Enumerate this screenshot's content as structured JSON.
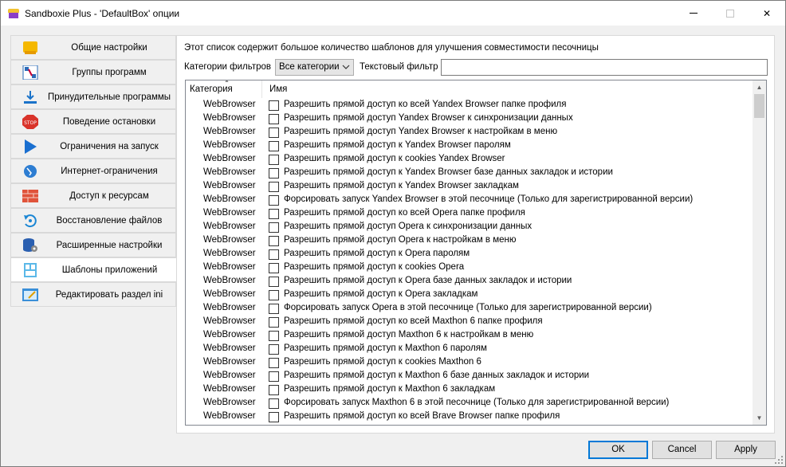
{
  "window": {
    "title": "Sandboxie Plus - 'DefaultBox' опции",
    "minimize_glyph": "",
    "close_glyph": "✕"
  },
  "sidebar": {
    "items": [
      {
        "label": "Общие настройки",
        "icon": "general-settings-icon"
      },
      {
        "label": "Группы программ",
        "icon": "program-groups-icon"
      },
      {
        "label": "Принудительные программы",
        "icon": "forced-programs-icon"
      },
      {
        "label": "Поведение остановки",
        "icon": "stop-icon"
      },
      {
        "label": "Ограничения на запуск",
        "icon": "play-icon"
      },
      {
        "label": "Интернет-ограничения",
        "icon": "globe-icon"
      },
      {
        "label": "Доступ к ресурсам",
        "icon": "brick-wall-icon"
      },
      {
        "label": "Восстановление файлов",
        "icon": "recovery-icon"
      },
      {
        "label": "Расширенные настройки",
        "icon": "database-gear-icon"
      },
      {
        "label": "Шаблоны приложений",
        "icon": "templates-icon",
        "active": true
      },
      {
        "label": "Редактировать раздел ini",
        "icon": "edit-ini-icon"
      }
    ]
  },
  "templates": {
    "description": "Этот список содержит большое количество шаблонов для улучшения совместимости песочницы",
    "filter_categories_label": "Категории фильтров",
    "filter_categories_value": "Все категории",
    "text_filter_label": "Текстовый фильтр",
    "text_filter_value": "",
    "columns": {
      "category": "Категория",
      "name": "Имя"
    },
    "rows": [
      {
        "category": "WebBrowser",
        "name": "Разрешить прямой доступ ко всей Yandex Browser папке профиля"
      },
      {
        "category": "WebBrowser",
        "name": "Разрешить прямой доступ Yandex Browser к синхронизации данных"
      },
      {
        "category": "WebBrowser",
        "name": "Разрешить прямой доступ Yandex Browser к настройкам в меню"
      },
      {
        "category": "WebBrowser",
        "name": "Разрешить прямой доступ к Yandex Browser паролям"
      },
      {
        "category": "WebBrowser",
        "name": "Разрешить прямой доступ к cookies Yandex Browser"
      },
      {
        "category": "WebBrowser",
        "name": "Разрешить прямой доступ к Yandex Browser базе данных закладок и истории"
      },
      {
        "category": "WebBrowser",
        "name": "Разрешить прямой доступ к Yandex Browser закладкам"
      },
      {
        "category": "WebBrowser",
        "name": "Форсировать запуск Yandex Browser в этой песочнице (Только для зарегистрированной версии)"
      },
      {
        "category": "WebBrowser",
        "name": "Разрешить прямой доступ ко всей Opera папке профиля"
      },
      {
        "category": "WebBrowser",
        "name": "Разрешить прямой доступ Opera к синхронизации данных"
      },
      {
        "category": "WebBrowser",
        "name": "Разрешить прямой доступ Opera к настройкам в меню"
      },
      {
        "category": "WebBrowser",
        "name": "Разрешить прямой доступ к Opera паролям"
      },
      {
        "category": "WebBrowser",
        "name": "Разрешить прямой доступ к cookies Opera"
      },
      {
        "category": "WebBrowser",
        "name": "Разрешить прямой доступ к Opera базе данных закладок и истории"
      },
      {
        "category": "WebBrowser",
        "name": "Разрешить прямой доступ к Opera закладкам"
      },
      {
        "category": "WebBrowser",
        "name": "Форсировать запуск Opera в этой песочнице (Только для зарегистрированной версии)"
      },
      {
        "category": "WebBrowser",
        "name": "Разрешить прямой доступ ко всей Maxthon 6 папке профиля"
      },
      {
        "category": "WebBrowser",
        "name": "Разрешить прямой доступ Maxthon 6 к настройкам в меню"
      },
      {
        "category": "WebBrowser",
        "name": "Разрешить прямой доступ к Maxthon 6 паролям"
      },
      {
        "category": "WebBrowser",
        "name": "Разрешить прямой доступ к cookies Maxthon 6"
      },
      {
        "category": "WebBrowser",
        "name": "Разрешить прямой доступ к Maxthon 6 базе данных закладок и истории"
      },
      {
        "category": "WebBrowser",
        "name": "Разрешить прямой доступ к Maxthon 6 закладкам"
      },
      {
        "category": "WebBrowser",
        "name": "Форсировать запуск Maxthon 6 в этой песочнице (Только для зарегистрированной версии)"
      },
      {
        "category": "WebBrowser",
        "name": "Разрешить прямой доступ ко всей Brave Browser папке профиля"
      }
    ]
  },
  "buttons": {
    "ok": "OK",
    "cancel": "Cancel",
    "apply": "Apply"
  },
  "colors": {
    "accent": "#0078d7",
    "active_item_bg": "#ffffff",
    "window_bg": "#f0f0f0"
  }
}
